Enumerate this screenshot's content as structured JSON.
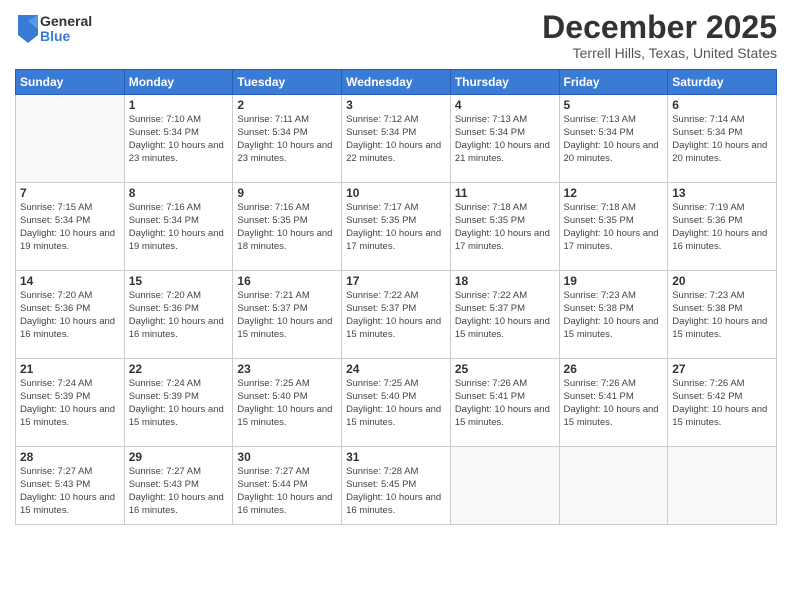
{
  "logo": {
    "general": "General",
    "blue": "Blue"
  },
  "header": {
    "month": "December 2025",
    "location": "Terrell Hills, Texas, United States"
  },
  "weekdays": [
    "Sunday",
    "Monday",
    "Tuesday",
    "Wednesday",
    "Thursday",
    "Friday",
    "Saturday"
  ],
  "weeks": [
    [
      {
        "day": "",
        "info": ""
      },
      {
        "day": "1",
        "info": "Sunrise: 7:10 AM\nSunset: 5:34 PM\nDaylight: 10 hours\nand 23 minutes."
      },
      {
        "day": "2",
        "info": "Sunrise: 7:11 AM\nSunset: 5:34 PM\nDaylight: 10 hours\nand 23 minutes."
      },
      {
        "day": "3",
        "info": "Sunrise: 7:12 AM\nSunset: 5:34 PM\nDaylight: 10 hours\nand 22 minutes."
      },
      {
        "day": "4",
        "info": "Sunrise: 7:13 AM\nSunset: 5:34 PM\nDaylight: 10 hours\nand 21 minutes."
      },
      {
        "day": "5",
        "info": "Sunrise: 7:13 AM\nSunset: 5:34 PM\nDaylight: 10 hours\nand 20 minutes."
      },
      {
        "day": "6",
        "info": "Sunrise: 7:14 AM\nSunset: 5:34 PM\nDaylight: 10 hours\nand 20 minutes."
      }
    ],
    [
      {
        "day": "7",
        "info": "Sunrise: 7:15 AM\nSunset: 5:34 PM\nDaylight: 10 hours\nand 19 minutes."
      },
      {
        "day": "8",
        "info": "Sunrise: 7:16 AM\nSunset: 5:34 PM\nDaylight: 10 hours\nand 19 minutes."
      },
      {
        "day": "9",
        "info": "Sunrise: 7:16 AM\nSunset: 5:35 PM\nDaylight: 10 hours\nand 18 minutes."
      },
      {
        "day": "10",
        "info": "Sunrise: 7:17 AM\nSunset: 5:35 PM\nDaylight: 10 hours\nand 17 minutes."
      },
      {
        "day": "11",
        "info": "Sunrise: 7:18 AM\nSunset: 5:35 PM\nDaylight: 10 hours\nand 17 minutes."
      },
      {
        "day": "12",
        "info": "Sunrise: 7:18 AM\nSunset: 5:35 PM\nDaylight: 10 hours\nand 17 minutes."
      },
      {
        "day": "13",
        "info": "Sunrise: 7:19 AM\nSunset: 5:36 PM\nDaylight: 10 hours\nand 16 minutes."
      }
    ],
    [
      {
        "day": "14",
        "info": "Sunrise: 7:20 AM\nSunset: 5:36 PM\nDaylight: 10 hours\nand 16 minutes."
      },
      {
        "day": "15",
        "info": "Sunrise: 7:20 AM\nSunset: 5:36 PM\nDaylight: 10 hours\nand 16 minutes."
      },
      {
        "day": "16",
        "info": "Sunrise: 7:21 AM\nSunset: 5:37 PM\nDaylight: 10 hours\nand 15 minutes."
      },
      {
        "day": "17",
        "info": "Sunrise: 7:22 AM\nSunset: 5:37 PM\nDaylight: 10 hours\nand 15 minutes."
      },
      {
        "day": "18",
        "info": "Sunrise: 7:22 AM\nSunset: 5:37 PM\nDaylight: 10 hours\nand 15 minutes."
      },
      {
        "day": "19",
        "info": "Sunrise: 7:23 AM\nSunset: 5:38 PM\nDaylight: 10 hours\nand 15 minutes."
      },
      {
        "day": "20",
        "info": "Sunrise: 7:23 AM\nSunset: 5:38 PM\nDaylight: 10 hours\nand 15 minutes."
      }
    ],
    [
      {
        "day": "21",
        "info": "Sunrise: 7:24 AM\nSunset: 5:39 PM\nDaylight: 10 hours\nand 15 minutes."
      },
      {
        "day": "22",
        "info": "Sunrise: 7:24 AM\nSunset: 5:39 PM\nDaylight: 10 hours\nand 15 minutes."
      },
      {
        "day": "23",
        "info": "Sunrise: 7:25 AM\nSunset: 5:40 PM\nDaylight: 10 hours\nand 15 minutes."
      },
      {
        "day": "24",
        "info": "Sunrise: 7:25 AM\nSunset: 5:40 PM\nDaylight: 10 hours\nand 15 minutes."
      },
      {
        "day": "25",
        "info": "Sunrise: 7:26 AM\nSunset: 5:41 PM\nDaylight: 10 hours\nand 15 minutes."
      },
      {
        "day": "26",
        "info": "Sunrise: 7:26 AM\nSunset: 5:41 PM\nDaylight: 10 hours\nand 15 minutes."
      },
      {
        "day": "27",
        "info": "Sunrise: 7:26 AM\nSunset: 5:42 PM\nDaylight: 10 hours\nand 15 minutes."
      }
    ],
    [
      {
        "day": "28",
        "info": "Sunrise: 7:27 AM\nSunset: 5:43 PM\nDaylight: 10 hours\nand 15 minutes."
      },
      {
        "day": "29",
        "info": "Sunrise: 7:27 AM\nSunset: 5:43 PM\nDaylight: 10 hours\nand 16 minutes."
      },
      {
        "day": "30",
        "info": "Sunrise: 7:27 AM\nSunset: 5:44 PM\nDaylight: 10 hours\nand 16 minutes."
      },
      {
        "day": "31",
        "info": "Sunrise: 7:28 AM\nSunset: 5:45 PM\nDaylight: 10 hours\nand 16 minutes."
      },
      {
        "day": "",
        "info": ""
      },
      {
        "day": "",
        "info": ""
      },
      {
        "day": "",
        "info": ""
      }
    ]
  ]
}
